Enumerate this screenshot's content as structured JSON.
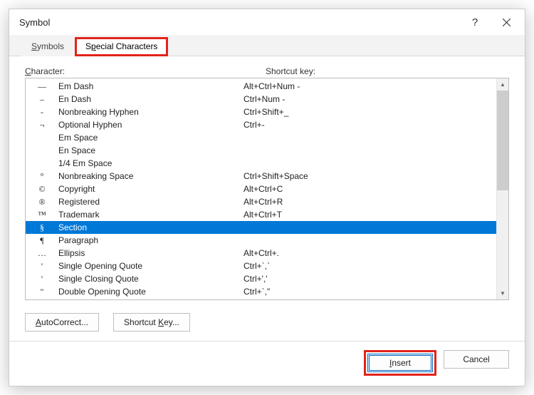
{
  "dialog": {
    "title": "Symbol"
  },
  "tabs": {
    "symbols_pre": "S",
    "symbols_rest": "ymbols",
    "special_pre": "S",
    "special_mnem": "p",
    "special_rest": "ecial Characters"
  },
  "headers": {
    "character_pre": "C",
    "character_rest": "haracter:",
    "shortcut": "Shortcut key:"
  },
  "rows": [
    {
      "sym": "—",
      "name": "Em Dash",
      "key": "Alt+Ctrl+Num -",
      "selected": false
    },
    {
      "sym": "–",
      "name": "En Dash",
      "key": "Ctrl+Num -",
      "selected": false
    },
    {
      "sym": "-",
      "name": "Nonbreaking Hyphen",
      "key": "Ctrl+Shift+_",
      "selected": false
    },
    {
      "sym": "¬",
      "name": "Optional Hyphen",
      "key": "Ctrl+-",
      "selected": false
    },
    {
      "sym": "",
      "name": "Em Space",
      "key": "",
      "selected": false
    },
    {
      "sym": "",
      "name": "En Space",
      "key": "",
      "selected": false
    },
    {
      "sym": "",
      "name": "1/4 Em Space",
      "key": "",
      "selected": false
    },
    {
      "sym": "°",
      "name": "Nonbreaking Space",
      "key": "Ctrl+Shift+Space",
      "selected": false
    },
    {
      "sym": "©",
      "name": "Copyright",
      "key": "Alt+Ctrl+C",
      "selected": false
    },
    {
      "sym": "®",
      "name": "Registered",
      "key": "Alt+Ctrl+R",
      "selected": false
    },
    {
      "sym": "™",
      "name": "Trademark",
      "key": "Alt+Ctrl+T",
      "selected": false
    },
    {
      "sym": "§",
      "name": "Section",
      "key": "",
      "selected": true
    },
    {
      "sym": "¶",
      "name": "Paragraph",
      "key": "",
      "selected": false
    },
    {
      "sym": "…",
      "name": "Ellipsis",
      "key": "Alt+Ctrl+.",
      "selected": false
    },
    {
      "sym": "'",
      "name": "Single Opening Quote",
      "key": "Ctrl+`,`",
      "selected": false
    },
    {
      "sym": "'",
      "name": "Single Closing Quote",
      "key": "Ctrl+','",
      "selected": false
    },
    {
      "sym": "\"",
      "name": "Double Opening Quote",
      "key": "Ctrl+`,\"",
      "selected": false
    }
  ],
  "buttons": {
    "autocorrect_pre": "A",
    "autocorrect_rest": "utoCorrect...",
    "shortcut_label": "Shortcut ",
    "shortcut_mnem": "K",
    "shortcut_rest": "ey...",
    "insert_pre": "I",
    "insert_rest": "nsert",
    "cancel": "Cancel"
  }
}
